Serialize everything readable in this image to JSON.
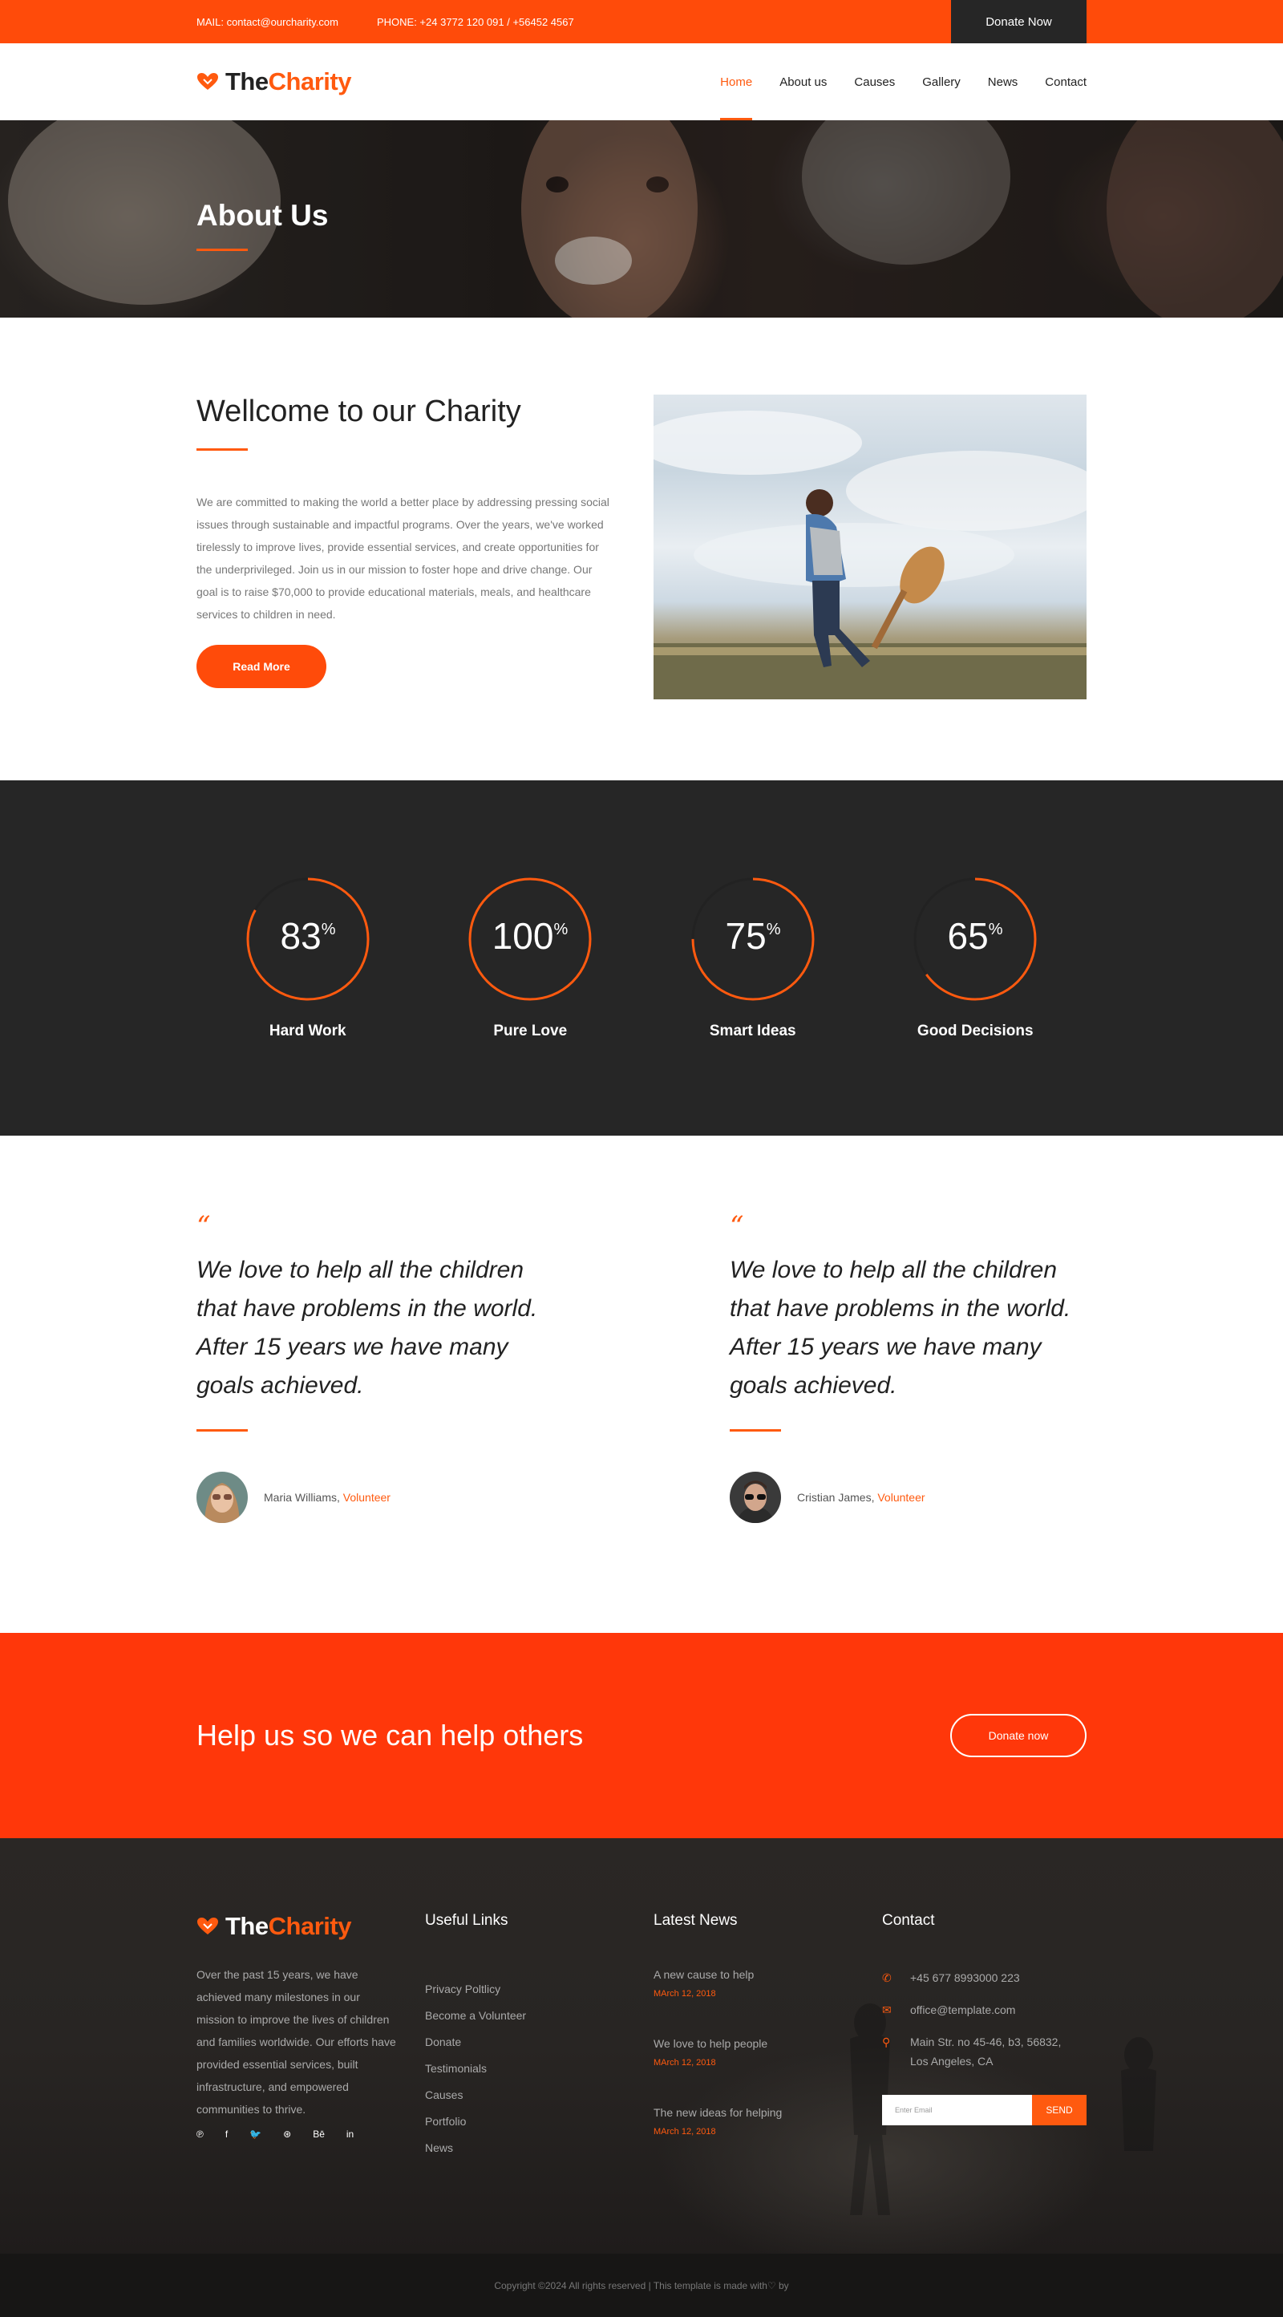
{
  "topbar": {
    "mail": "MAIL: contact@ourcharity.com",
    "phone": "PHONE: +24 3772 120 091 / +56452 4567",
    "donate": "Donate Now"
  },
  "brand": {
    "part1": "The",
    "part2": "Charity"
  },
  "nav": {
    "items": [
      {
        "label": "Home",
        "active": true
      },
      {
        "label": "About us"
      },
      {
        "label": "Causes"
      },
      {
        "label": "Gallery"
      },
      {
        "label": "News"
      },
      {
        "label": "Contact"
      }
    ]
  },
  "hero": {
    "title": "About Us"
  },
  "welcome": {
    "title": "Wellcome to our Charity",
    "text": "We are committed to making the world a better place by addressing pressing social issues through sustainable and impactful programs. Over the years, we've worked tirelessly to improve lives, provide essential services, and create opportunities for the underprivileged. Join us in our mission to foster hope and drive change. Our goal is to raise $70,000 to provide educational materials, meals, and healthcare services to children in need.",
    "button": "Read More"
  },
  "stats": [
    {
      "value": "83",
      "unit": "%",
      "label": "Hard Work",
      "percent": 83
    },
    {
      "value": "100",
      "unit": "%",
      "label": "Pure Love",
      "percent": 100
    },
    {
      "value": "75",
      "unit": "%",
      "label": "Smart Ideas",
      "percent": 75
    },
    {
      "value": "65",
      "unit": "%",
      "label": "Good Decisions",
      "percent": 65
    }
  ],
  "testimonials": [
    {
      "mark": "“",
      "quote": "We love to help all the children that have problems in the world. After 15 years we have many goals achieved.",
      "name": "Maria Williams,",
      "role": "Volunteer"
    },
    {
      "mark": "“",
      "quote": "We love to help all the children that have problems in the world. After 15 years we have many goals achieved.",
      "name": "Cristian James,",
      "role": "Volunteer"
    }
  ],
  "cta": {
    "title": "Help us so we can help others",
    "button": "Donate now"
  },
  "footer": {
    "about": "Over the past 15 years, we have achieved many milestones in our mission to improve the lives of children and families worldwide. Our efforts have provided essential services, built infrastructure, and empowered communities to thrive.",
    "socials": [
      "pinterest-icon",
      "facebook-icon",
      "twitter-icon",
      "dribbble-icon",
      "behance-icon",
      "linkedin-icon"
    ],
    "social_glyphs": [
      "℗",
      "f",
      "🐦",
      "⊛",
      "Bē",
      "in"
    ],
    "links_title": "Useful Links",
    "links": [
      "Privacy Poltlicy",
      "Become a Volunteer",
      "Donate",
      "Testimonials",
      "Causes",
      "Portfolio",
      "News"
    ],
    "news_title": "Latest News",
    "news": [
      {
        "title": "A new cause to help",
        "date": "MArch 12, 2018"
      },
      {
        "title": "We love to help people",
        "date": "MArch 12, 2018"
      },
      {
        "title": "The new ideas for helping",
        "date": "MArch 12, 2018"
      }
    ],
    "contact_title": "Contact",
    "phone": "+45 677 8993000 223",
    "email": "office@template.com",
    "address_1": "Main Str. no 45-46, b3, 56832,",
    "address_2": "Los Angeles, CA",
    "newsletter_placeholder": "Enter Email",
    "send": "SEND"
  },
  "copyright": "Copyright ©2024 All rights reserved | This template is made with♡ by",
  "colors": {
    "accent": "#ff5a0f",
    "dark": "#262626"
  }
}
